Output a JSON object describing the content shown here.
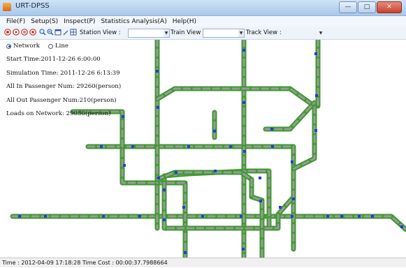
{
  "window": {
    "title": "URT-DPSS",
    "min_label": "—",
    "max_label": "□",
    "close_label": "✕"
  },
  "menu": {
    "items": [
      "File(F)",
      "Setup(S)",
      "Inspect(P)",
      "Statistics Analysis(A)",
      "Help(H)"
    ]
  },
  "toolbar": {
    "icons": [
      "record-start-icon",
      "play-icon",
      "pause-icon",
      "stop-icon",
      "zoom-in-icon",
      "zoom-out-icon",
      "calendar-icon",
      "pen-icon",
      "grid-icon"
    ],
    "station_view_label": "Station View :",
    "train_view_label": "Train View :",
    "track_view_label": "Track View :",
    "station_view_value": "",
    "train_view_value": "",
    "track_view_value": ""
  },
  "info": {
    "mode_network": "Network",
    "mode_line": "Line",
    "mode_selected": "Network",
    "start_time": "Start Time:2011-12-26 6:00:00",
    "simulation_time": "Simulation Time: 2011-12-26 6:13:39",
    "all_in": "All In Passenger Num: 29260(person)",
    "all_out": "All Out Passenger Num:210(person)",
    "loads": "Loads on Network: 29050(person)"
  },
  "status": {
    "text": "Time : 2012-04-09 17:18:28  Time Cost : 00:00:37.7988664"
  },
  "colors": {
    "track": "#3d9a2f",
    "rail": "#9a9a9a",
    "train": "#1f3fd8",
    "window_accent": "#a9c8ea"
  }
}
